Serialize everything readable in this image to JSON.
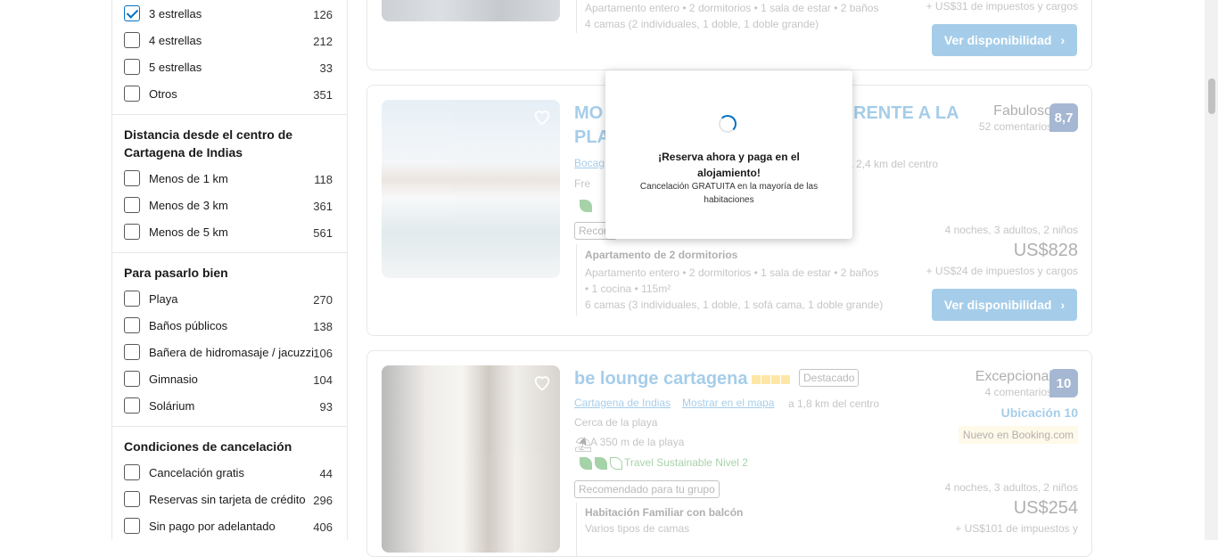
{
  "filters": {
    "stars": [
      {
        "label": "3 estrellas",
        "count": "126",
        "checked": true
      },
      {
        "label": "4 estrellas",
        "count": "212",
        "checked": false
      },
      {
        "label": "5 estrellas",
        "count": "33",
        "checked": false
      },
      {
        "label": "Otros",
        "count": "351",
        "checked": false
      }
    ],
    "distance": {
      "title": "Distancia desde el centro de Cartagena de Indias",
      "items": [
        {
          "label": "Menos de 1 km",
          "count": "118"
        },
        {
          "label": "Menos de 3 km",
          "count": "361"
        },
        {
          "label": "Menos de 5 km",
          "count": "561"
        }
      ]
    },
    "fun": {
      "title": "Para pasarlo bien",
      "items": [
        {
          "label": "Playa",
          "count": "270"
        },
        {
          "label": "Baños públicos",
          "count": "138"
        },
        {
          "label": "Bañera de hidromasaje / jacuzzi",
          "count": "106"
        },
        {
          "label": "Gimnasio",
          "count": "104"
        },
        {
          "label": "Solárium",
          "count": "93"
        }
      ]
    },
    "cancellation": {
      "title": "Condiciones de cancelación",
      "items": [
        {
          "label": "Cancelación gratis",
          "count": "44"
        },
        {
          "label": "Reservas sin tarjeta de crédito",
          "count": "296"
        },
        {
          "label": "Sin pago por adelantado",
          "count": "406"
        }
      ]
    }
  },
  "card0": {
    "details1": "Apartamento entero • 2 dormitorios • 1 sala de estar • 2 baños",
    "details2": "4 camas (2 individuales, 1 doble, 1 doble grande)",
    "taxes": "+ US$31 de impuestos y cargos",
    "button": "Ver disponibilidad"
  },
  "card1": {
    "title_line1": "MO",
    "title_line1b": "RENTE A LA",
    "title_line2": "PLA",
    "location": "Bocag",
    "distance": "a 2,4 km del centro",
    "amenity": "Fre",
    "recommended": "Recom",
    "rating_word": "Fabuloso",
    "reviews": "52 comentarios",
    "score": "8,7",
    "room_title": "Apartamento de 2 dormitorios",
    "details1": "Apartamento entero • 2 dormitorios • 1 sala de estar • 2 baños",
    "details2": "• 1 cocina • 115m²",
    "details3": "6 camas (3 individuales, 1 doble, 1 sofá cama, 1 doble grande)",
    "stay": "4 noches, 3 adultos, 2 niños",
    "price": "US$828",
    "taxes": "+ US$24 de impuestos y cargos",
    "button": "Ver disponibilidad"
  },
  "card2": {
    "title": "be lounge cartagena",
    "badge": "Destacado",
    "location": "Cartagena de Indias",
    "map_link": "Mostrar en el mapa",
    "distance": "a 1,8 km del centro",
    "beach": "Cerca de la playa",
    "beach_distance": "A 350 m de la playa",
    "sustainable": "Travel Sustainable Nivel 2",
    "recommended": "Recomendado para tu grupo",
    "rating_word": "Excepcional",
    "reviews": "4 comentarios",
    "score": "10",
    "location_score": "Ubicación 10",
    "new_badge": "Nuevo en Booking.com",
    "room_title": "Habitación Familiar con balcón",
    "room_sub": "Varios tipos de camas",
    "stay": "4 noches, 3 adultos, 2 niños",
    "price": "US$254",
    "taxes": "+ US$101 de impuestos y"
  },
  "popup": {
    "title": "¡Reserva ahora y paga en el alojamiento!",
    "text": "Cancelación GRATUITA en la mayoría de las habitaciones"
  },
  "colors": {
    "accent": "#0071c2",
    "score_bg": "#003580",
    "new_badge_bg": "#fff0c1"
  }
}
